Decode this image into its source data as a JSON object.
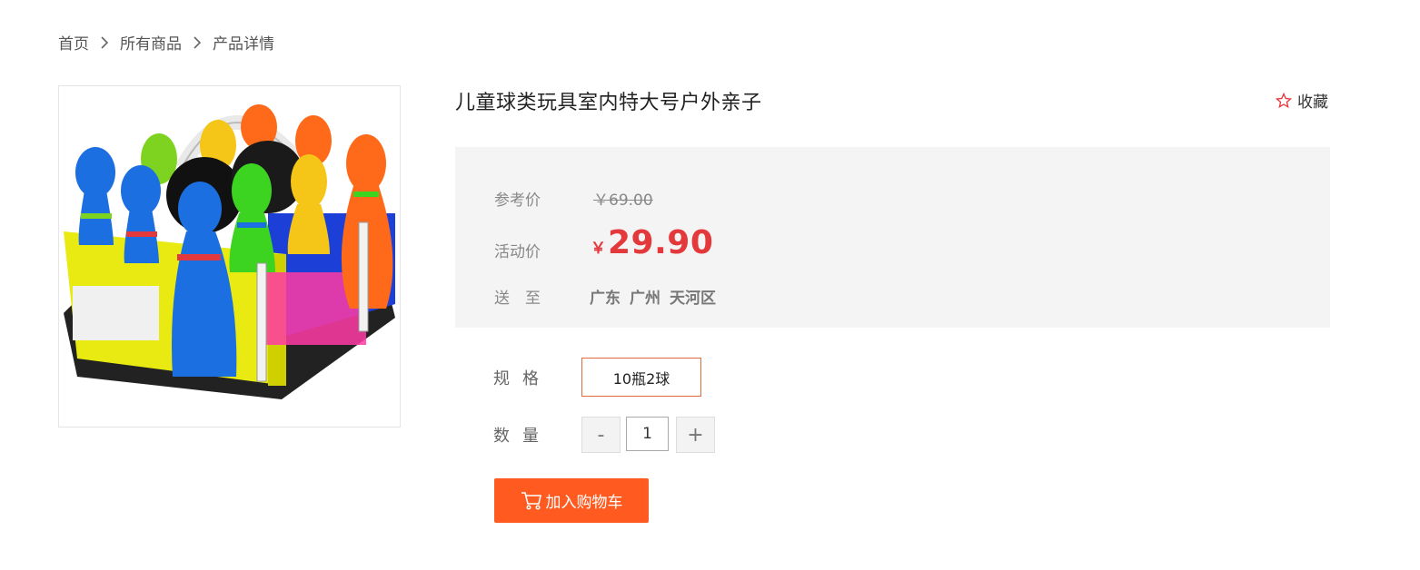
{
  "breadcrumb": {
    "items": [
      "首页",
      "所有商品",
      "产品详情"
    ]
  },
  "product": {
    "title": "儿童球类玩具室内特大号户外亲子",
    "favorite_label": "收藏",
    "image_name": "bowling-toy-set"
  },
  "price": {
    "ref_label": "参考价",
    "ref_value": "￥69.00",
    "promo_label": "活动价",
    "currency": "￥",
    "promo_value": "29.90",
    "ship_label": "送　至",
    "ship_province": "广东",
    "ship_city": "广州",
    "ship_district": "天河区"
  },
  "spec": {
    "label": "规格",
    "option": "10瓶2球"
  },
  "quantity": {
    "label": "数量",
    "minus": "-",
    "value": "1",
    "plus": "+"
  },
  "cart": {
    "label": "加入购物车"
  },
  "colors": {
    "accent": "#ff5a1f",
    "price": "#e4393c",
    "panel": "#f4f4f4"
  }
}
